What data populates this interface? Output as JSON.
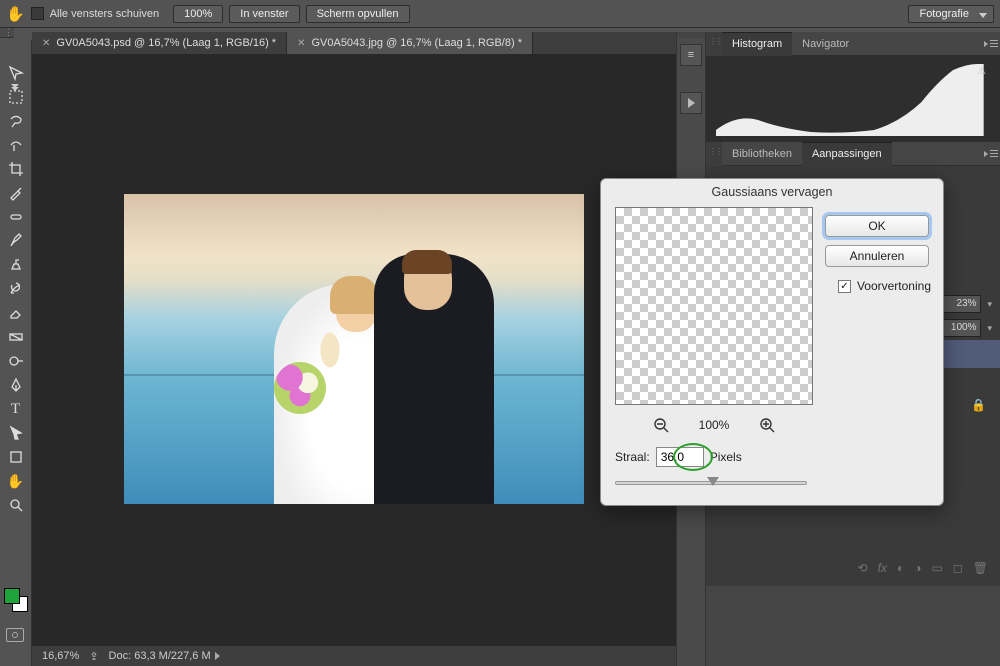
{
  "topbar": {
    "all_windows_label": "Alle vensters schuiven",
    "zoom_100": "100%",
    "fit_window": "In venster",
    "fill_screen": "Scherm opvullen",
    "workspace": "Fotografie"
  },
  "tabs": [
    {
      "title": "GV0A5043.psd @ 16,7% (Laag 1, RGB/16) *",
      "active": false
    },
    {
      "title": "GV0A5043.jpg @ 16,7% (Laag 1, RGB/8) *",
      "active": true
    }
  ],
  "status": {
    "zoom": "16,67%",
    "doc_size": "Doc: 63,3 M/227,6 M"
  },
  "panels": {
    "histogram_tab": "Histogram",
    "navigator_tab": "Navigator",
    "libraries_tab": "Bibliotheken",
    "adjustments_tab": "Aanpassingen",
    "opacity_value": "23%",
    "fill_value": "100%"
  },
  "dialog": {
    "title": "Gaussiaans vervagen",
    "ok": "OK",
    "cancel": "Annuleren",
    "preview_label": "Voorvertoning",
    "zoom": "100%",
    "radius_label": "Straal:",
    "radius_value": "36,0",
    "radius_unit": "Pixels"
  },
  "colors": {
    "foreground_swatch": "#1fa43b",
    "background_swatch": "#ffffff"
  }
}
